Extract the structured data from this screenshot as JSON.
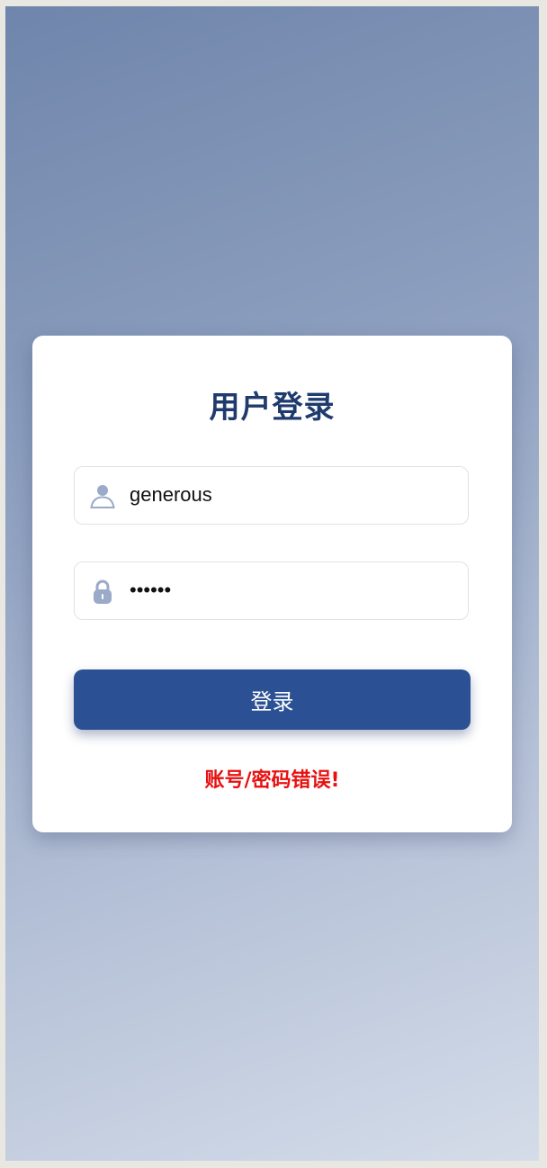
{
  "login": {
    "title": "用户登录",
    "username": {
      "value": "generous",
      "icon": "user-icon"
    },
    "password": {
      "value": "••••••",
      "icon": "lock-icon"
    },
    "submit_label": "登录",
    "error_message": "账号/密码错误!"
  },
  "colors": {
    "title": "#1f3a6d",
    "button": "#2b5194",
    "error": "#e81010",
    "icon": "#9aaac8"
  }
}
